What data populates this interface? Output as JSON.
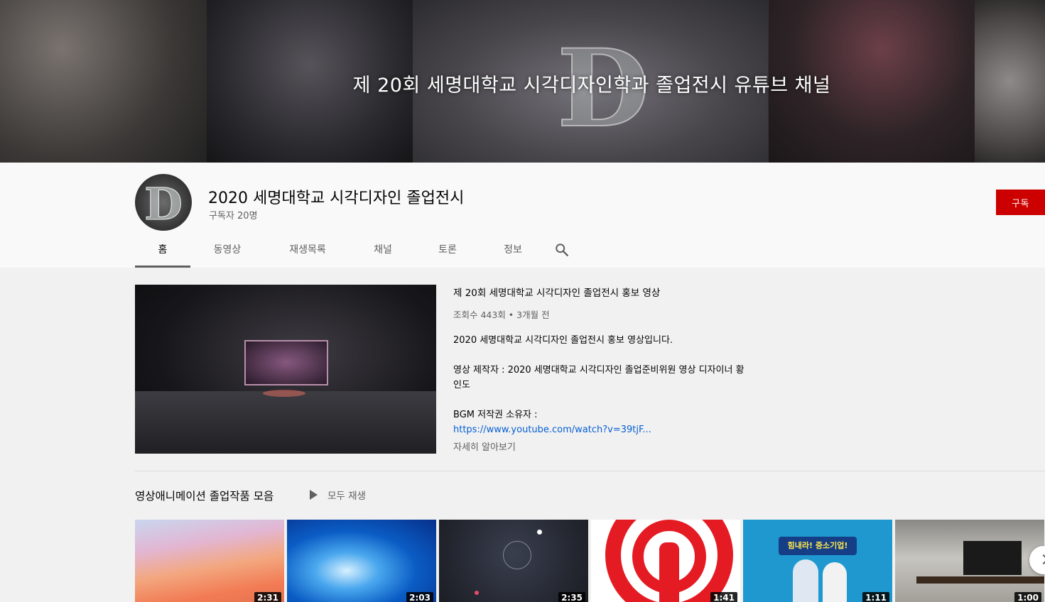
{
  "banner": {
    "title": "제 20회 세명대학교 시각디자인학과 졸업전시 유튜브 채널"
  },
  "channel": {
    "name": "2020 세명대학교 시각디자인 졸업전시",
    "subscribers": "구독자 20명",
    "subscribe_label": "구독"
  },
  "tabs": [
    {
      "label": "홈",
      "active": true
    },
    {
      "label": "동영상"
    },
    {
      "label": "재생목록"
    },
    {
      "label": "채널"
    },
    {
      "label": "토론"
    },
    {
      "label": "정보"
    }
  ],
  "featured": {
    "title": "제 20회 세명대학교 시각디자인 졸업전시 홍보 영상",
    "meta": "조회수 443회 • 3개월 전",
    "desc_line1": "2020 세명대학교 시각디자인 졸업전시 홍보 영상입니다.",
    "desc_line2": "영상 제작자 : 2020 세명대학교 시각디자인 졸업준비위원 영상 디자이너 황인도",
    "desc_line3": "BGM 저작권 소유자 :",
    "desc_link": "https://www.youtube.com/watch?v=39tjF...",
    "more_label": "자세히 알아보기"
  },
  "shelf": {
    "title": "영상애니메이션 졸업작품 모음",
    "play_all_label": "모두 재생",
    "videos": [
      {
        "duration": "2:31"
      },
      {
        "duration": "2:03"
      },
      {
        "duration": "2:35"
      },
      {
        "duration": "1:41"
      },
      {
        "duration": "1:11",
        "caption": "힘내라! 중소기업!"
      },
      {
        "duration": "1:00"
      }
    ]
  },
  "icons": {
    "search": "search-icon",
    "play_all": "play-icon",
    "next": "chevron-right-icon"
  },
  "colors": {
    "subscribe": "#cc0000",
    "link": "#065fd4",
    "secondary_text": "#606060"
  }
}
